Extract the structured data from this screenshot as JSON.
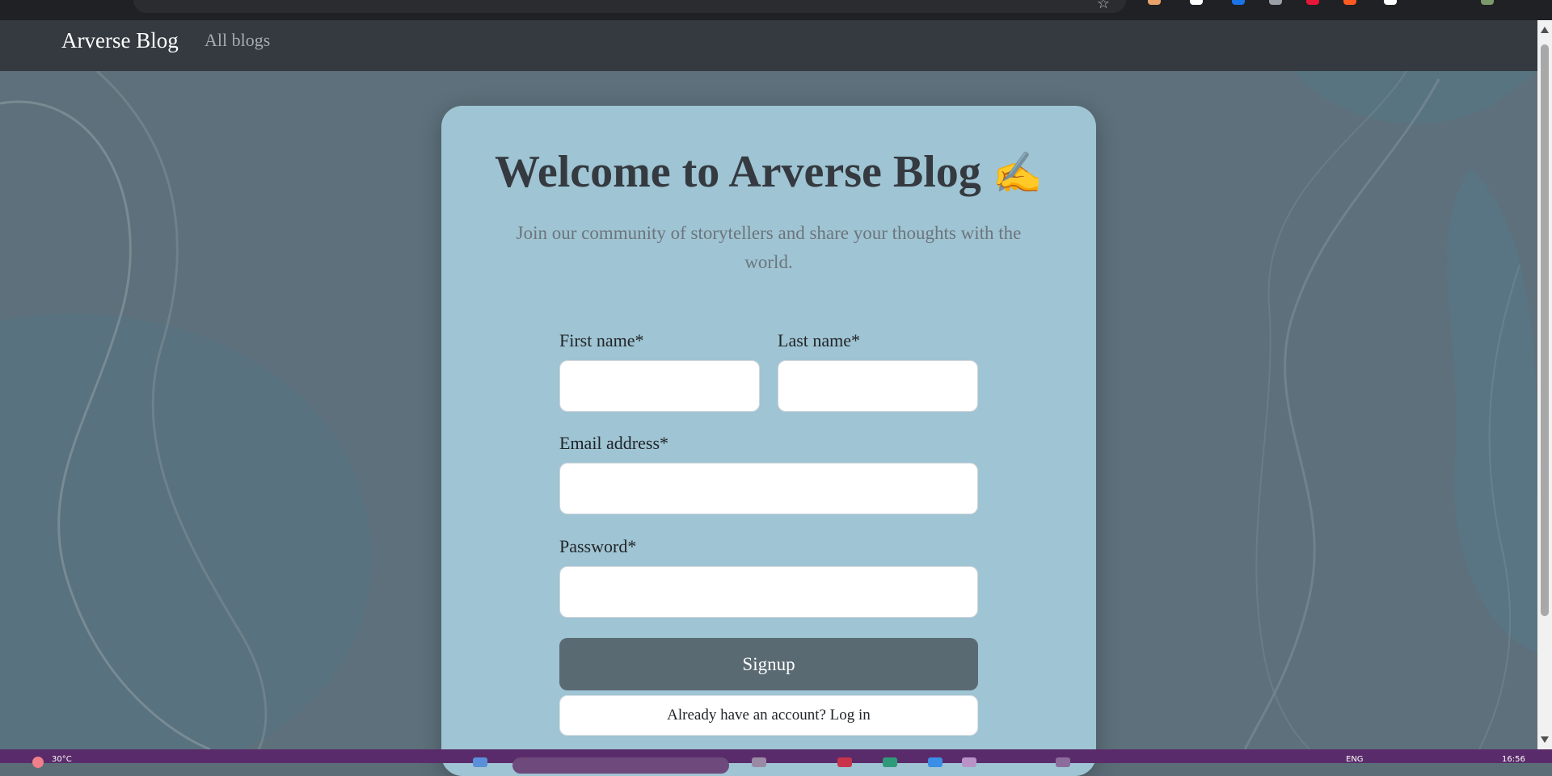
{
  "navbar": {
    "brand": "Arverse Blog",
    "links": [
      {
        "label": "All blogs"
      }
    ]
  },
  "signup": {
    "title": "Welcome to Arverse Blog",
    "title_emoji": "✍️",
    "subtitle": "Join our community of storytellers and share your thoughts with the world.",
    "fields": {
      "first_name": {
        "label": "First name*",
        "value": ""
      },
      "last_name": {
        "label": "Last name*",
        "value": ""
      },
      "email": {
        "label": "Email address*",
        "value": ""
      },
      "password": {
        "label": "Password*",
        "value": ""
      }
    },
    "submit_label": "Signup",
    "login_label": "Already have an account? Log in"
  },
  "taskbar": {
    "weather": "30°C",
    "language": "ENG",
    "time": "16:56"
  },
  "colors": {
    "navbar_bg": "#343a40",
    "page_bg": "#5d707b",
    "card_bg": "#9fc4d3",
    "button_bg": "#5a6a73",
    "taskbar_bg": "#5a2b6a"
  }
}
